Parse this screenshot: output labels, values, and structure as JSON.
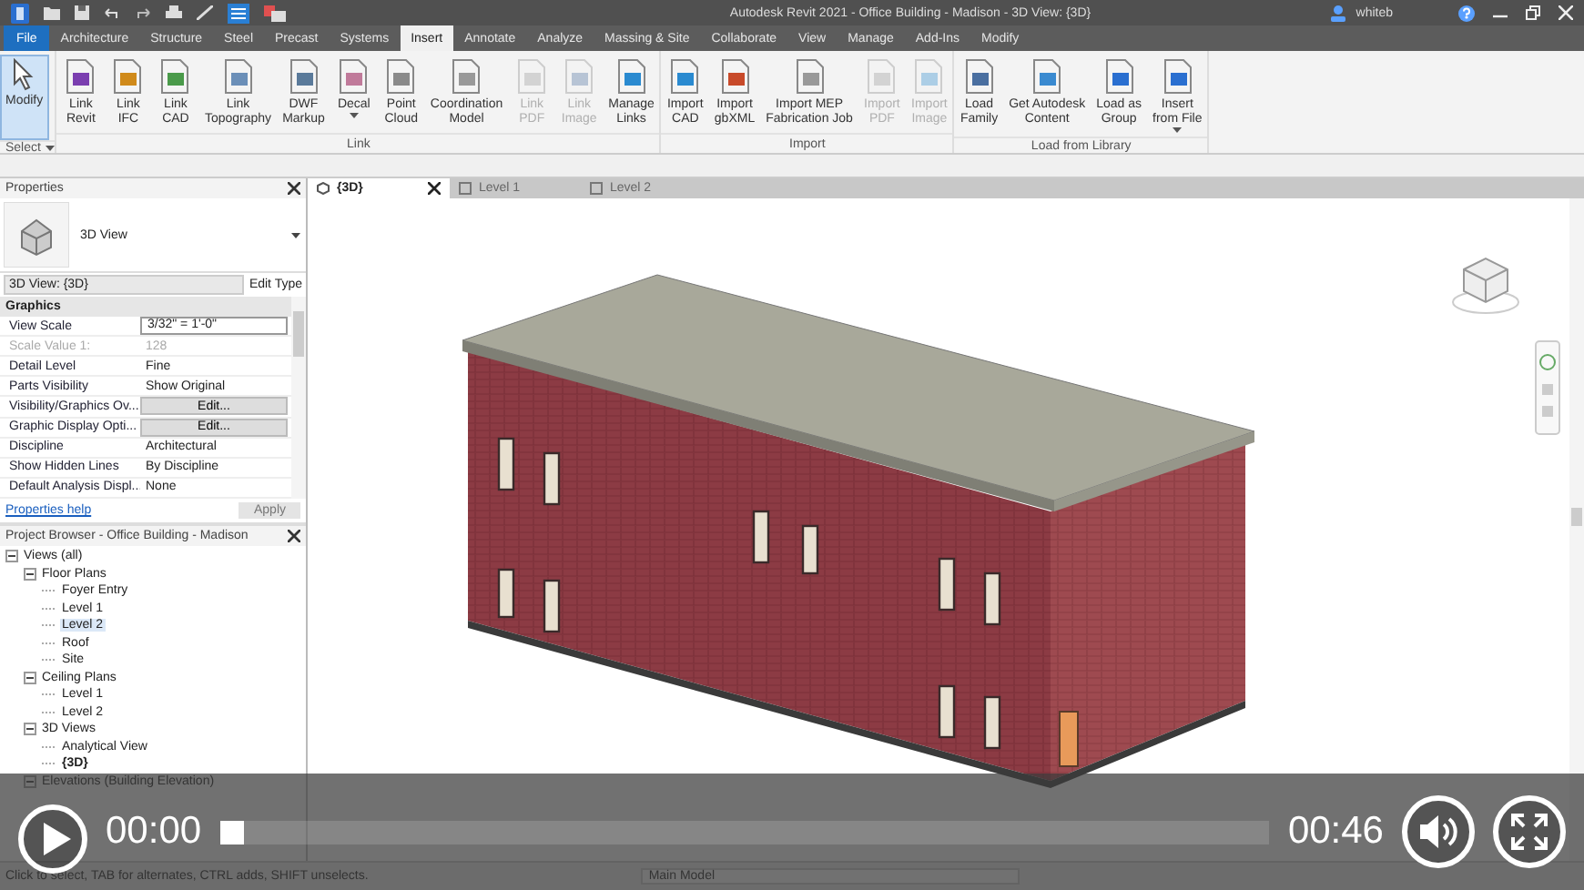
{
  "window": {
    "title": "Autodesk Revit 2021 - Office Building - Madison - 3D View: {3D}",
    "user": "whiteb"
  },
  "ribbon_tabs": [
    {
      "label": "File",
      "kind": "file",
      "selected": false
    },
    {
      "label": "Architecture",
      "kind": "tab",
      "selected": false
    },
    {
      "label": "Structure",
      "kind": "tab",
      "selected": false
    },
    {
      "label": "Steel",
      "kind": "tab",
      "selected": false
    },
    {
      "label": "Precast",
      "kind": "tab",
      "selected": false
    },
    {
      "label": "Systems",
      "kind": "tab",
      "selected": false
    },
    {
      "label": "Insert",
      "kind": "tab",
      "selected": true
    },
    {
      "label": "Annotate",
      "kind": "tab",
      "selected": false
    },
    {
      "label": "Analyze",
      "kind": "tab",
      "selected": false
    },
    {
      "label": "Massing & Site",
      "kind": "tab",
      "selected": false
    },
    {
      "label": "Collaborate",
      "kind": "tab",
      "selected": false
    },
    {
      "label": "View",
      "kind": "tab",
      "selected": false
    },
    {
      "label": "Manage",
      "kind": "tab",
      "selected": false
    },
    {
      "label": "Add-Ins",
      "kind": "tab",
      "selected": false
    },
    {
      "label": "Modify",
      "kind": "tab",
      "selected": false
    }
  ],
  "ribbon_panels": [
    {
      "label": "Select",
      "dropdown": true,
      "buttons": [
        {
          "lines": [
            "Modify"
          ],
          "selected": true,
          "disabled": false,
          "dropdown": false
        }
      ]
    },
    {
      "label": "Link",
      "dropdown": false,
      "buttons": [
        {
          "lines": [
            "Link",
            "Revit"
          ],
          "selected": false,
          "disabled": false,
          "dropdown": false
        },
        {
          "lines": [
            "Link",
            "IFC"
          ],
          "selected": false,
          "disabled": false,
          "dropdown": false
        },
        {
          "lines": [
            "Link",
            "CAD"
          ],
          "selected": false,
          "disabled": false,
          "dropdown": false
        },
        {
          "lines": [
            "Link",
            "Topography"
          ],
          "selected": false,
          "disabled": false,
          "dropdown": false
        },
        {
          "lines": [
            "DWF",
            "Markup"
          ],
          "selected": false,
          "disabled": false,
          "dropdown": false
        },
        {
          "lines": [
            "Decal"
          ],
          "selected": false,
          "disabled": false,
          "dropdown": true
        },
        {
          "lines": [
            "Point",
            "Cloud"
          ],
          "selected": false,
          "disabled": false,
          "dropdown": false
        },
        {
          "lines": [
            "Coordination",
            "Model"
          ],
          "selected": false,
          "disabled": false,
          "dropdown": false
        },
        {
          "lines": [
            "Link",
            "PDF"
          ],
          "selected": false,
          "disabled": true,
          "dropdown": false
        },
        {
          "lines": [
            "Link",
            "Image"
          ],
          "selected": false,
          "disabled": true,
          "dropdown": false
        },
        {
          "lines": [
            "Manage",
            "Links"
          ],
          "selected": false,
          "disabled": false,
          "dropdown": false
        }
      ]
    },
    {
      "label": "Import",
      "dropdown": false,
      "buttons": [
        {
          "lines": [
            "Import",
            "CAD"
          ],
          "selected": false,
          "disabled": false,
          "dropdown": false
        },
        {
          "lines": [
            "Import",
            "gbXML"
          ],
          "selected": false,
          "disabled": false,
          "dropdown": false
        },
        {
          "lines": [
            "Import MEP",
            "Fabrication Job"
          ],
          "selected": false,
          "disabled": false,
          "dropdown": false
        },
        {
          "lines": [
            "Import",
            "PDF"
          ],
          "selected": false,
          "disabled": true,
          "dropdown": false
        },
        {
          "lines": [
            "Import",
            "Image"
          ],
          "selected": false,
          "disabled": true,
          "dropdown": false
        }
      ]
    },
    {
      "label": "Load from Library",
      "dropdown": false,
      "buttons": [
        {
          "lines": [
            "Load",
            "Family"
          ],
          "selected": false,
          "disabled": false,
          "dropdown": false
        },
        {
          "lines": [
            "Get Autodesk",
            "Content"
          ],
          "selected": false,
          "disabled": false,
          "dropdown": false
        },
        {
          "lines": [
            "Load as",
            "Group"
          ],
          "selected": false,
          "disabled": false,
          "dropdown": false
        },
        {
          "lines": [
            "Insert",
            "from File"
          ],
          "selected": false,
          "disabled": false,
          "dropdown": true
        }
      ]
    }
  ],
  "properties": {
    "title": "Properties",
    "type_name": "3D View",
    "selector": "3D View: {3D}",
    "edit_type": "Edit Type",
    "section": "Graphics",
    "rows": [
      {
        "name": "View Scale",
        "value": "3/32\" = 1'-0\"",
        "kind": "field",
        "disabled": false
      },
      {
        "name": "Scale Value    1:",
        "value": "128",
        "kind": "text",
        "disabled": true
      },
      {
        "name": "Detail Level",
        "value": "Fine",
        "kind": "text",
        "disabled": false
      },
      {
        "name": "Parts Visibility",
        "value": "Show Original",
        "kind": "text",
        "disabled": false
      },
      {
        "name": "Visibility/Graphics Ov...",
        "value": "Edit...",
        "kind": "button",
        "disabled": false
      },
      {
        "name": "Graphic Display Opti...",
        "value": "Edit...",
        "kind": "button",
        "disabled": false
      },
      {
        "name": "Discipline",
        "value": "Architectural",
        "kind": "text",
        "disabled": false
      },
      {
        "name": "Show Hidden Lines",
        "value": "By Discipline",
        "kind": "text",
        "disabled": false
      },
      {
        "name": "Default Analysis Displ...",
        "value": "None",
        "kind": "text",
        "disabled": false
      }
    ],
    "help_link": "Properties help",
    "apply": {
      "label": "Apply",
      "disabled": true
    }
  },
  "project_browser": {
    "title": "Project Browser - Office Building - Madison",
    "tree": [
      {
        "label": "Views (all)",
        "expanded": true,
        "selected": false,
        "open": false,
        "children": [
          {
            "label": "Floor Plans",
            "expanded": true,
            "selected": false,
            "open": false,
            "children": [
              {
                "label": "Foyer Entry",
                "selected": false,
                "open": false
              },
              {
                "label": "Level 1",
                "selected": false,
                "open": false
              },
              {
                "label": "Level 2",
                "selected": true,
                "open": false
              },
              {
                "label": "Roof",
                "selected": false,
                "open": false
              },
              {
                "label": "Site",
                "selected": false,
                "open": false
              }
            ]
          },
          {
            "label": "Ceiling Plans",
            "expanded": true,
            "selected": false,
            "open": false,
            "children": [
              {
                "label": "Level 1",
                "selected": false,
                "open": false
              },
              {
                "label": "Level 2",
                "selected": false,
                "open": false
              }
            ]
          },
          {
            "label": "3D Views",
            "expanded": true,
            "selected": false,
            "open": false,
            "children": [
              {
                "label": "Analytical View",
                "selected": false,
                "open": false
              },
              {
                "label": "{3D}",
                "selected": false,
                "open": true
              }
            ]
          },
          {
            "label": "Elevations (Building Elevation)",
            "expanded": true,
            "selected": false,
            "open": false
          }
        ]
      }
    ]
  },
  "view_tabs": [
    {
      "label": "{3D}",
      "kind": "model",
      "selected": true
    },
    {
      "label": "Level 1",
      "kind": "plan",
      "selected": false
    },
    {
      "label": "Level 2",
      "kind": "plan",
      "selected": false
    }
  ],
  "status_bar": {
    "message": "Click to select, TAB for alternates, CTRL adds, SHIFT unselects.",
    "workset": "Main Model"
  },
  "video_player": {
    "playing": false,
    "current_time": "00:00",
    "duration": "00:46",
    "level": 0
  }
}
